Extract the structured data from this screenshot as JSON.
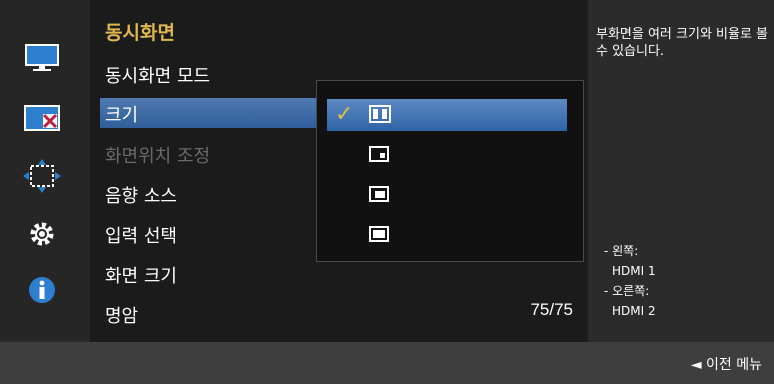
{
  "menu": {
    "title": "동시화면",
    "items": [
      {
        "label": "동시화면 모드"
      },
      {
        "label": "크기"
      },
      {
        "label": "화면위치 조정"
      },
      {
        "label": "음향 소스"
      },
      {
        "label": "입력 선택"
      },
      {
        "label": "화면 크기"
      },
      {
        "label": "명암"
      }
    ],
    "contrast_value": "75/75"
  },
  "popup": {
    "options": [
      {
        "icon": "size-large-icon",
        "selected": true
      },
      {
        "icon": "size-small-icon",
        "selected": false
      },
      {
        "icon": "size-medium-icon",
        "selected": false
      },
      {
        "icon": "size-wide-icon",
        "selected": false
      }
    ],
    "check": "✓"
  },
  "help": {
    "text": "부화면을 여러 크기와 비율로 볼 수 있습니다.",
    "left_label": "- 왼쪽:",
    "left_source": "HDMI 1",
    "right_label": "- 오른쪽:",
    "right_source": "HDMI 2"
  },
  "footer": {
    "back_label": "◄ 이전 메뉴"
  },
  "colors": {
    "accent_title": "#e0b84f",
    "selection": "#3b6aa8"
  }
}
